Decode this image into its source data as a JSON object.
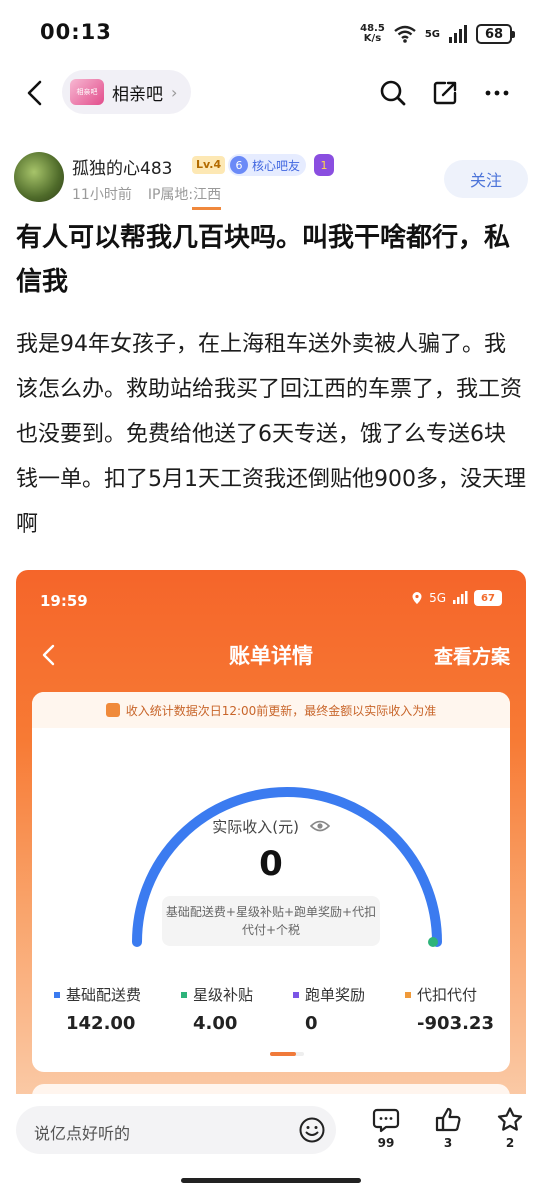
{
  "status_bar": {
    "time": "00:13",
    "net_speed_value": "48.5",
    "net_speed_unit": "K/s",
    "network": "5G",
    "battery": "68"
  },
  "nav": {
    "forum_name": "相亲吧",
    "forum_thumb_text": "相亲吧"
  },
  "author": {
    "name": "孤独的心483",
    "level": "Lv.4",
    "core_badge_num": "6",
    "core_badge_label": "核心吧友",
    "purple_badge_num": "1",
    "time_ago": "11小时前",
    "ip_location": "IP属地:江西",
    "follow_label": "关注"
  },
  "post": {
    "title": "有人可以帮我几百块吗。叫我干啥都行，私信我",
    "body": "我是94年女孩子，在上海租车送外卖被人骗了。我该怎么办。救助站给我买了回江西的车票了，我工资也没要到。免费给他送了6天专送，饿了么专送6块钱一单。扣了5月1天工资我还倒贴他900多，没天理啊"
  },
  "screenshot": {
    "time": "19:59",
    "network": "5G",
    "battery": "67",
    "title": "账单详情",
    "plan_link": "查看方案",
    "notice": "收入统计数据次日12:00前更新，最终金额以实际收入为准",
    "income_label": "实际收入(元)",
    "income_value": "0",
    "formula_line1": "基础配送费+星级补贴+跑单奖励+代扣",
    "formula_line2": "代付+个税",
    "metrics": [
      {
        "label": "基础配送费",
        "value": "142.00",
        "color": "#3b7bf0"
      },
      {
        "label": "星级补贴",
        "value": "4.00",
        "color": "#2eb37a"
      },
      {
        "label": "跑单奖励",
        "value": "0",
        "color": "#7b55e6"
      },
      {
        "label": "代扣代付",
        "value": "-903.23",
        "color": "#f09a3a"
      }
    ],
    "accent_color": "#f5652a",
    "gauge_color": "#3b7bf0"
  },
  "bottom_bar": {
    "comment_placeholder": "说亿点好听的",
    "comment_count": "99",
    "like_count": "3",
    "favorite_count": "2"
  }
}
